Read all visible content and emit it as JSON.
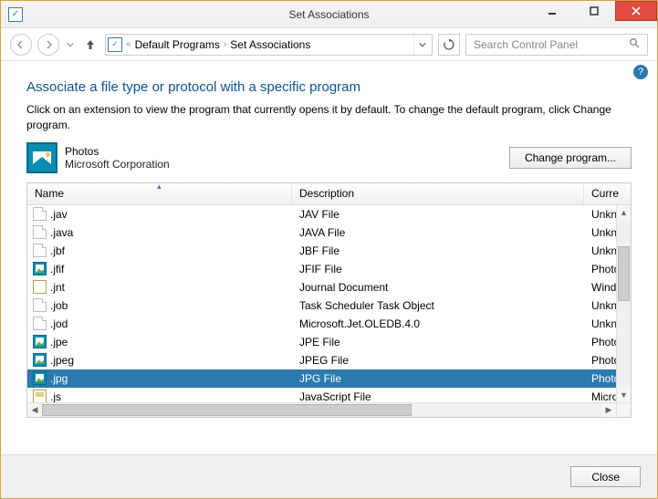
{
  "window": {
    "title": "Set Associations"
  },
  "breadcrumb": {
    "seg1": "Default Programs",
    "seg2": "Set Associations"
  },
  "search": {
    "placeholder": "Search Control Panel"
  },
  "page": {
    "heading": "Associate a file type or protocol with a specific program",
    "subtext": "Click on an extension to view the program that currently opens it by default. To change the default program, click Change program.",
    "app_name": "Photos",
    "publisher": "Microsoft Corporation",
    "change_btn": "Change program..."
  },
  "columns": {
    "name": "Name",
    "desc": "Description",
    "curr": "Curre"
  },
  "rows": [
    {
      "icon": "blank",
      "ext": ".jav",
      "desc": "JAV File",
      "curr": "Unkno",
      "selected": false
    },
    {
      "icon": "blank",
      "ext": ".java",
      "desc": "JAVA File",
      "curr": "Unkno",
      "selected": false
    },
    {
      "icon": "blank",
      "ext": ".jbf",
      "desc": "JBF File",
      "curr": "Unkno",
      "selected": false
    },
    {
      "icon": "photo",
      "ext": ".jfif",
      "desc": "JFIF File",
      "curr": "Photo",
      "selected": false
    },
    {
      "icon": "jnt",
      "ext": ".jnt",
      "desc": "Journal Document",
      "curr": "Winde",
      "selected": false
    },
    {
      "icon": "blank",
      "ext": ".job",
      "desc": "Task Scheduler Task Object",
      "curr": "Unkno",
      "selected": false
    },
    {
      "icon": "blank",
      "ext": ".jod",
      "desc": "Microsoft.Jet.OLEDB.4.0",
      "curr": "Unkno",
      "selected": false
    },
    {
      "icon": "photo",
      "ext": ".jpe",
      "desc": "JPE File",
      "curr": "Photo",
      "selected": false
    },
    {
      "icon": "photo",
      "ext": ".jpeg",
      "desc": "JPEG File",
      "curr": "Photo",
      "selected": false
    },
    {
      "icon": "photo",
      "ext": ".jpg",
      "desc": "JPG File",
      "curr": "Photo",
      "selected": true
    },
    {
      "icon": "js",
      "ext": ".js",
      "desc": "JavaScript File",
      "curr": "Micro",
      "selected": false
    }
  ],
  "footer": {
    "close": "Close"
  }
}
